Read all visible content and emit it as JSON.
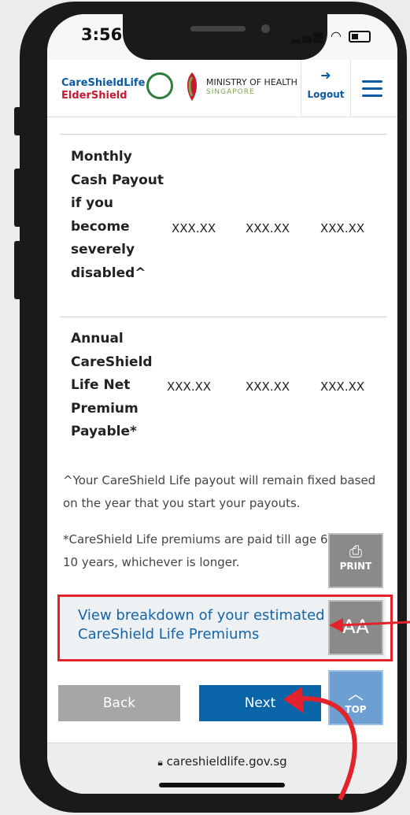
{
  "status": {
    "time": "3:56"
  },
  "header": {
    "brand_line1": "CareShieldLife",
    "brand_line2": "ElderShield",
    "moh_name": "MINISTRY OF HEALTH",
    "moh_sub": "SINGAPORE",
    "logout_label": "Logout"
  },
  "table": {
    "rows": [
      {
        "label": "Monthly Cash Payout if you become severely disabled^",
        "values": [
          "XXX.XX",
          "XXX.XX",
          "XXX.XX"
        ]
      },
      {
        "label": "Annual CareShield Life Net Premium Payable*",
        "values": [
          "XXX.XX",
          "XXX.XX",
          "XXX.XX"
        ]
      }
    ]
  },
  "notes": {
    "payout_note": "^Your CareShield Life payout will remain fixed based on the year that you start your payouts.",
    "premium_note": "*CareShield Life premiums are paid till age 67, or for 10 years, whichever is longer."
  },
  "link": {
    "breakdown": "View breakdown of your estimated CareShield Life Premiums"
  },
  "buttons": {
    "back": "Back",
    "next": "Next"
  },
  "floating": {
    "print": "PRINT",
    "font": "AA",
    "top": "TOP"
  },
  "browser": {
    "url": "careshieldlife.gov.sg"
  },
  "colors": {
    "accent": "#0a64a8",
    "highlight": "#e3232b"
  }
}
